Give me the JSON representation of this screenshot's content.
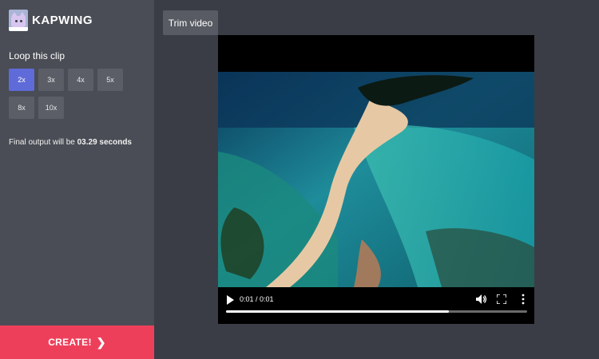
{
  "app": {
    "name": "KAPWING"
  },
  "sidebar": {
    "loop_label": "Loop this clip",
    "multipliers": [
      {
        "label": "2x",
        "selected": true
      },
      {
        "label": "3x",
        "selected": false
      },
      {
        "label": "4x",
        "selected": false
      },
      {
        "label": "5x",
        "selected": false
      },
      {
        "label": "8x",
        "selected": false
      },
      {
        "label": "10x",
        "selected": false
      }
    ],
    "output_prefix": "Final output will be",
    "output_value": "03.29 seconds",
    "create_label": "CREATE!"
  },
  "toolbar": {
    "trim_label": "Trim video"
  },
  "player": {
    "time": "0:01 / 0:01",
    "progress": 0.74
  },
  "colors": {
    "accent": "#5e6bd8",
    "create": "#ee3f5a",
    "sidebar": "#4a4d55",
    "background": "#3a3d45"
  }
}
